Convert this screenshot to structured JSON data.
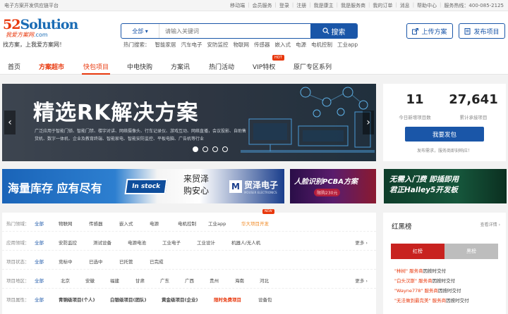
{
  "topbar": {
    "left": "电子方案开发供应链平台",
    "links": [
      "移动端",
      "会员服务",
      "登录",
      "注册",
      "我是康主",
      "我是服务商",
      "我的订单",
      "消息",
      "帮助中心",
      "服务热线：400-085-2125"
    ]
  },
  "logo": {
    "brand_num": "52",
    "brand_text": "Solution",
    "sub": "我爱方案网",
    "sub_com": ".com",
    "slogan": "找方案，上我爱方案网！"
  },
  "search": {
    "select": "全部",
    "placeholder": "请输入关键词",
    "button": "搜索"
  },
  "hot_keywords": {
    "label": "热门搜索：",
    "items": [
      "智能家居",
      "汽车电子",
      "安防监控",
      "物联网",
      "传感器",
      "嵌入式",
      "电源",
      "电机控制",
      "工业app"
    ]
  },
  "header_buttons": {
    "upload": "上传方案",
    "publish": "发布项目"
  },
  "nav": {
    "items": [
      "首页",
      "方案超市",
      "快包项目",
      "中电快购",
      "方案讯",
      "热门活动",
      "VIP特权",
      "原厂专区系列"
    ],
    "hot_badge": "HOT"
  },
  "banner": {
    "title": "精选RK解决方案",
    "desc": "广泛应用于智能门锁、智能门禁、楼宇对讲、网络摄像头、行车记录仪、游戏互动、网络直播，会议投影、自助售货机、数字一体机、企业及教育终端、智能家电、智能安防监控、平板电脑、广告机等行业"
  },
  "stats": {
    "new_projects": "11",
    "new_projects_label": "今日新增项目数",
    "total_projects": "27,641",
    "total_projects_label": "累计承接项目",
    "publish_button": "我要发包",
    "note": "发布需求，服务商即刻响应！"
  },
  "ads": {
    "ad1_text1": "海量库存 应有尽有",
    "ad1_stock": "In stock",
    "ad1_text2a": "来贸泽",
    "ad1_text2b": "购安心",
    "ad1_brand": "贸泽电子",
    "ad1_brand_en": "MOUSER ELECTRONICS",
    "ad2_text": "人脸识别PCBA方案",
    "ad2_price": "限购230元",
    "ad3_line1": "无需入门费 即插即用",
    "ad3_line2": "君正Halley5开发板"
  },
  "filters": {
    "rows": [
      {
        "label": "热门领域：",
        "options": [
          "全部",
          "物联网",
          "传感器",
          "嵌入式",
          "电源",
          "电机控制",
          "工业app",
          "华大项目开发"
        ],
        "new_badge": "NEW"
      },
      {
        "label": "应用领域：",
        "options": [
          "全部",
          "安防监控",
          "测试设备",
          "电源电池",
          "工业电子",
          "工业设计",
          "机器人/无人机"
        ],
        "more": "更多"
      },
      {
        "label": "项目状态：",
        "options": [
          "全部",
          "竞标中",
          "已选中",
          "已托管",
          "已完成"
        ]
      },
      {
        "label": "项目地区：",
        "options": [
          "全部",
          "北京",
          "安徽",
          "福建",
          "甘肃",
          "广东",
          "广西",
          "贵州",
          "海南",
          "河北"
        ],
        "more": "更多"
      },
      {
        "label": "项目属性：",
        "options": [
          "全部",
          "青铜级项目(个人)",
          "白银级项目(团队)",
          "黄金级项目(企业)",
          "限时免费项目",
          "设备包"
        ]
      }
    ]
  },
  "rank": {
    "title": "红黑榜",
    "more": "查看详情",
    "tab_red": "红榜",
    "tab_black": "黑榜",
    "items": [
      {
        "user": "\"林树\"",
        "role": "服务商",
        "action": "因按时交付"
      },
      {
        "user": "\"白头汉斯\"",
        "role": "服务商",
        "action": "因按时交付"
      },
      {
        "user": "\"Wayne778\"",
        "role": "服务商",
        "action": "因按时交付"
      },
      {
        "user": "\"无法做到最完美\"",
        "role": "服务商",
        "action": "因按时交付"
      }
    ]
  },
  "colors": {
    "brand_blue": "#1a56a8",
    "accent_red": "#e8380d"
  }
}
